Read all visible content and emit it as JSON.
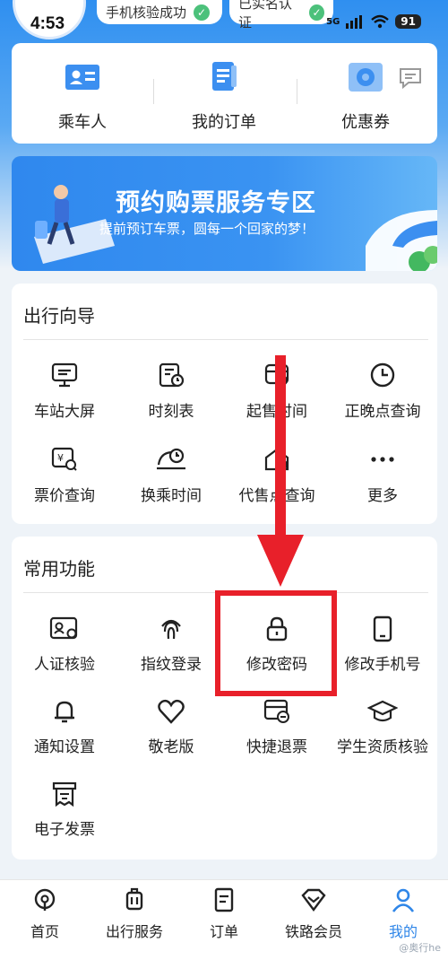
{
  "status_bar": {
    "time": "4:53",
    "badge_verified_phone": "手机核验成功",
    "badge_realname": "已实名认证",
    "network": "5G",
    "battery": "91"
  },
  "quick_menu": {
    "passengers": "乘车人",
    "my_orders": "我的订单",
    "coupons": "优惠券"
  },
  "banner": {
    "title": "预约购票服务专区",
    "subtitle": "提前预订车票，圆每一个回家的梦！"
  },
  "travel_guide": {
    "title": "出行向导",
    "items": [
      {
        "label": "车站大屏",
        "icon": "station-screen-icon"
      },
      {
        "label": "时刻表",
        "icon": "timetable-icon"
      },
      {
        "label": "起售时间",
        "icon": "sale-time-icon"
      },
      {
        "label": "正晚点查询",
        "icon": "clock-icon"
      },
      {
        "label": "票价查询",
        "icon": "fare-query-icon"
      },
      {
        "label": "换乘时间",
        "icon": "transfer-time-icon"
      },
      {
        "label": "代售点查询",
        "icon": "agency-query-icon"
      },
      {
        "label": "更多",
        "icon": "more-icon"
      }
    ]
  },
  "common_functions": {
    "title": "常用功能",
    "items": [
      {
        "label": "人证核验",
        "icon": "id-verify-icon"
      },
      {
        "label": "指纹登录",
        "icon": "fingerprint-icon"
      },
      {
        "label": "修改密码",
        "icon": "lock-icon"
      },
      {
        "label": "修改手机号",
        "icon": "phone-icon"
      },
      {
        "label": "通知设置",
        "icon": "bell-icon"
      },
      {
        "label": "敬老版",
        "icon": "heart-icon"
      },
      {
        "label": "快捷退票",
        "icon": "refund-icon"
      },
      {
        "label": "学生资质核验",
        "icon": "graduation-cap-icon"
      },
      {
        "label": "电子发票",
        "icon": "invoice-icon"
      }
    ]
  },
  "bottom_nav": {
    "items": [
      {
        "label": "首页"
      },
      {
        "label": "出行服务"
      },
      {
        "label": "订单"
      },
      {
        "label": "铁路会员"
      },
      {
        "label": "我的"
      }
    ],
    "active": "我的"
  },
  "watermark": "@奥行he",
  "colors": {
    "accent": "#2f86e8",
    "annotation_red": "#e8202a",
    "verified_green": "#4cc17b"
  }
}
